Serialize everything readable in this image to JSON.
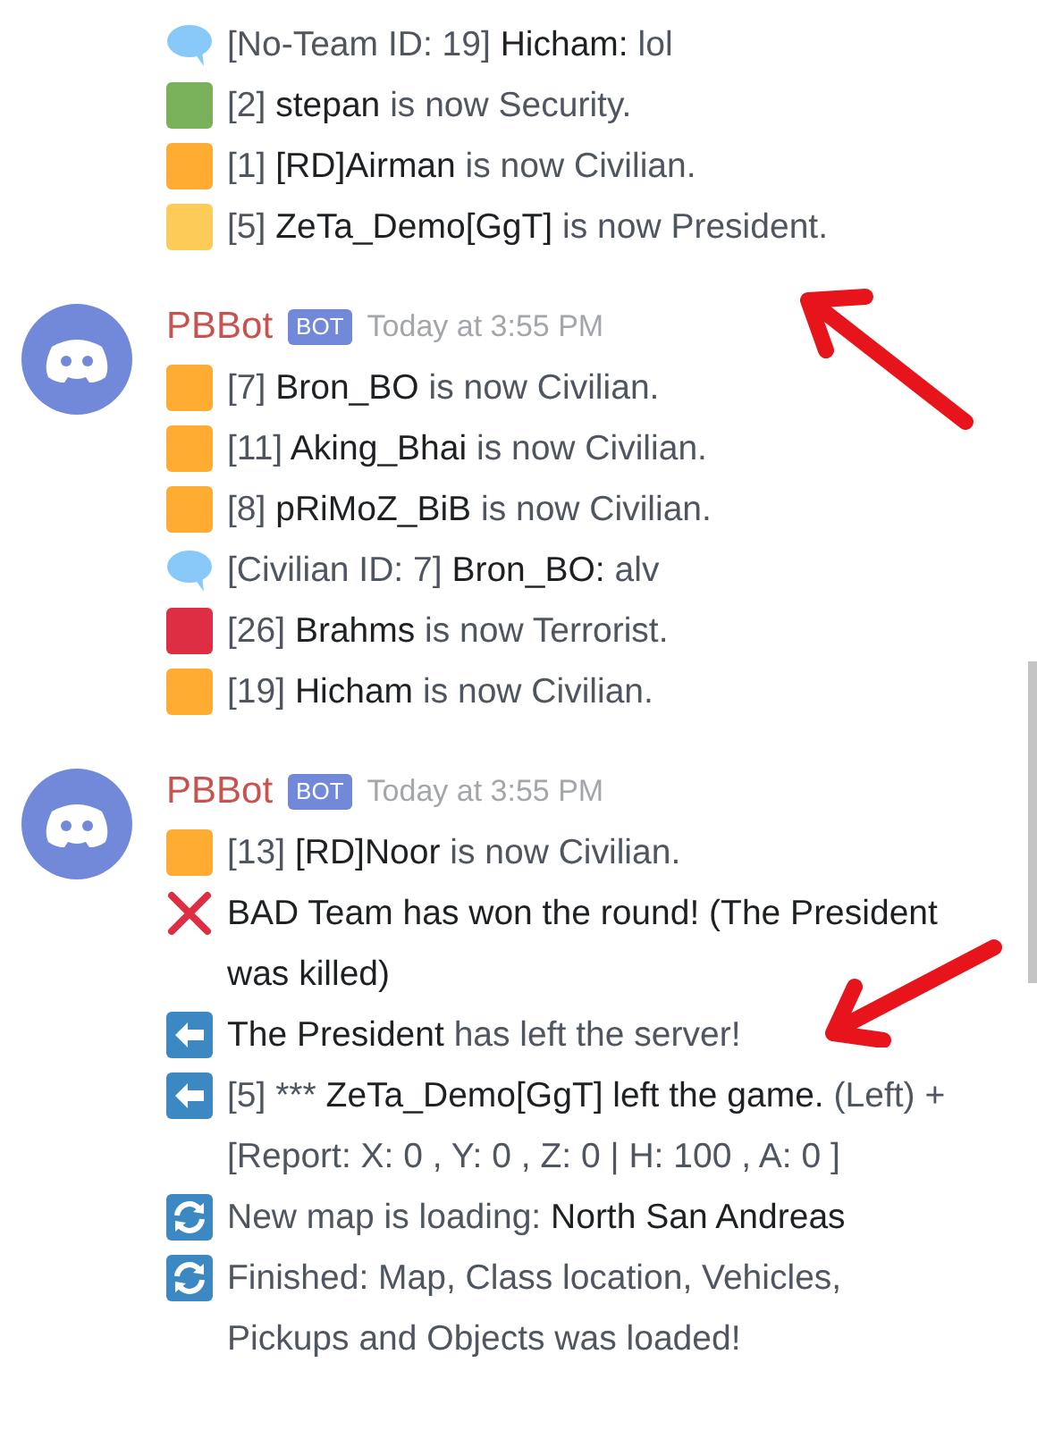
{
  "messages": [
    {
      "lines": [
        {
          "kind": "chat",
          "parts": [
            {
              "text": "[No-Team ID: 19] ",
              "strong": false
            },
            {
              "text": "Hicham:",
              "strong": true
            },
            {
              "text": " lol",
              "strong": false
            }
          ]
        },
        {
          "kind": "square",
          "color": "#78b159",
          "parts": [
            {
              "text": "[2] ",
              "strong": false
            },
            {
              "text": "stepan",
              "strong": true
            },
            {
              "text": " is now Security.",
              "strong": false
            }
          ]
        },
        {
          "kind": "square",
          "color": "#ffac33",
          "parts": [
            {
              "text": "[1] ",
              "strong": false
            },
            {
              "text": "[RD]Airman",
              "strong": true
            },
            {
              "text": " is now Civilian.",
              "strong": false
            }
          ]
        },
        {
          "kind": "square",
          "color": "#fdcb58",
          "parts": [
            {
              "text": "[5] ",
              "strong": false
            },
            {
              "text": "ZeTa_Demo[GgT]",
              "strong": true
            },
            {
              "text": " is now President.",
              "strong": false
            }
          ]
        }
      ]
    },
    {
      "author": "PBBot",
      "badge": "BOT",
      "timestamp": "Today at 3:55 PM",
      "lines": [
        {
          "kind": "square",
          "color": "#ffac33",
          "parts": [
            {
              "text": "[7] ",
              "strong": false
            },
            {
              "text": "Bron_BO",
              "strong": true
            },
            {
              "text": " is now Civilian.",
              "strong": false
            }
          ]
        },
        {
          "kind": "square",
          "color": "#ffac33",
          "parts": [
            {
              "text": "[11] ",
              "strong": false
            },
            {
              "text": "Aking_Bhai",
              "strong": true
            },
            {
              "text": " is now Civilian.",
              "strong": false
            }
          ]
        },
        {
          "kind": "square",
          "color": "#ffac33",
          "parts": [
            {
              "text": "[8] ",
              "strong": false
            },
            {
              "text": "pRiMoZ_BiB",
              "strong": true
            },
            {
              "text": " is now Civilian.",
              "strong": false
            }
          ]
        },
        {
          "kind": "chat",
          "parts": [
            {
              "text": "[Civilian ID: 7] ",
              "strong": false
            },
            {
              "text": "Bron_BO:",
              "strong": true
            },
            {
              "text": " alv",
              "strong": false
            }
          ]
        },
        {
          "kind": "square",
          "color": "#dd2e44",
          "parts": [
            {
              "text": "[26] ",
              "strong": false
            },
            {
              "text": "Brahms",
              "strong": true
            },
            {
              "text": " is now Terrorist.",
              "strong": false
            }
          ]
        },
        {
          "kind": "square",
          "color": "#ffac33",
          "parts": [
            {
              "text": "[19] ",
              "strong": false
            },
            {
              "text": "Hicham",
              "strong": true
            },
            {
              "text": " is now Civilian.",
              "strong": false
            }
          ]
        }
      ]
    },
    {
      "author": "PBBot",
      "badge": "BOT",
      "timestamp": "Today at 3:55 PM",
      "lines": [
        {
          "kind": "square",
          "color": "#ffac33",
          "parts": [
            {
              "text": "[13] ",
              "strong": false
            },
            {
              "text": "[RD]Noor",
              "strong": true
            },
            {
              "text": " is now Civilian.",
              "strong": false
            }
          ]
        },
        {
          "kind": "cross",
          "parts": [
            {
              "text": "BAD Team has won the round! (The President was killed)",
              "strong": true
            }
          ]
        },
        {
          "kind": "left",
          "parts": [
            {
              "text": "The President",
              "strong": true
            },
            {
              "text": " has left the server!",
              "strong": false
            }
          ]
        },
        {
          "kind": "left",
          "parts": [
            {
              "text": "[5] *** ",
              "strong": false
            },
            {
              "text": "ZeTa_Demo[GgT] left the game.",
              "strong": true
            },
            {
              "text": " (Left) + [Report: X: 0 , Y: 0 , Z: 0 | H: 100 , A: 0 ]",
              "strong": false
            }
          ]
        },
        {
          "kind": "refresh",
          "parts": [
            {
              "text": "New map is loading: ",
              "strong": false
            },
            {
              "text": "North San Andreas",
              "strong": true
            }
          ]
        },
        {
          "kind": "refresh",
          "parts": [
            {
              "text": "Finished: Map, Class location, Vehicles, Pickups and Objects was loaded!",
              "strong": false
            }
          ]
        }
      ]
    }
  ]
}
